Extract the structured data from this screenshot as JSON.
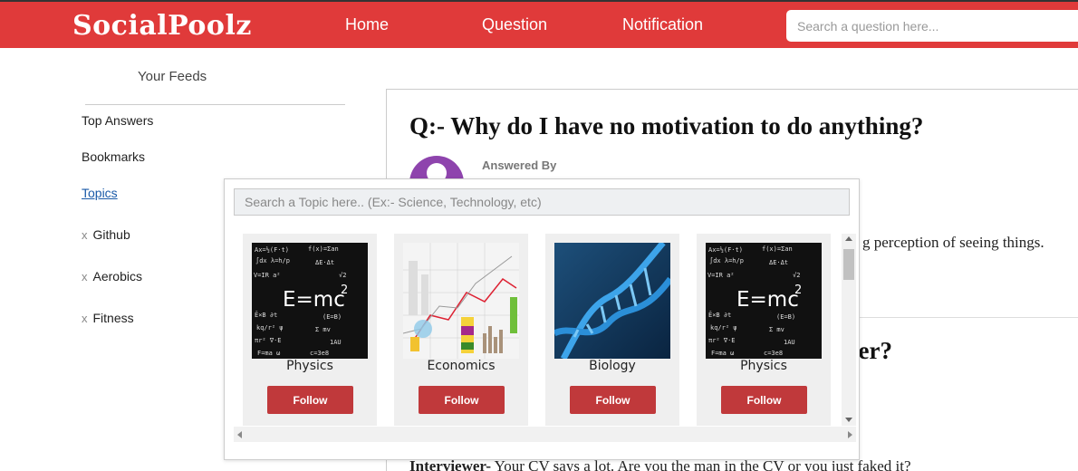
{
  "app": {
    "logo": "SocialPoolz"
  },
  "nav": {
    "home": "Home",
    "question": "Question",
    "notification": "Notification",
    "search_placeholder": "Search a question here..."
  },
  "sidebar": {
    "title": "Your Feeds",
    "links": {
      "top_answers": "Top Answers",
      "bookmarks": "Bookmarks",
      "topics": "Topics"
    },
    "topics": [
      {
        "remove": "x",
        "label": "Github"
      },
      {
        "remove": "x",
        "label": "Aerobics"
      },
      {
        "remove": "x",
        "label": "Fitness"
      }
    ]
  },
  "feed": {
    "question_title": "Q:-  Why do I have no motivation to do anything?",
    "answered_by": "Answered By",
    "answer_snippet": "g perception of seeing things.",
    "second_question_tail": "ver?",
    "interview_label": "Interviewer-",
    "interview_text": " Your CV says a lot. Are you the man in the CV or you just faked it?"
  },
  "topic_popup": {
    "search_placeholder": "Search a Topic here.. (Ex:- Science, Technology, etc)",
    "cards": [
      {
        "name": "Physics",
        "image": "physics-formula-chalkboard",
        "follow": "Follow"
      },
      {
        "name": "Economics",
        "image": "economics-charts",
        "follow": "Follow"
      },
      {
        "name": "Biology",
        "image": "dna-helix",
        "follow": "Follow"
      },
      {
        "name": "Physics",
        "image": "physics-formula-chalkboard",
        "follow": "Follow"
      }
    ]
  },
  "colors": {
    "brand": "#e03a3a",
    "follow_button": "#c0393b",
    "link": "#1a5aa8"
  }
}
